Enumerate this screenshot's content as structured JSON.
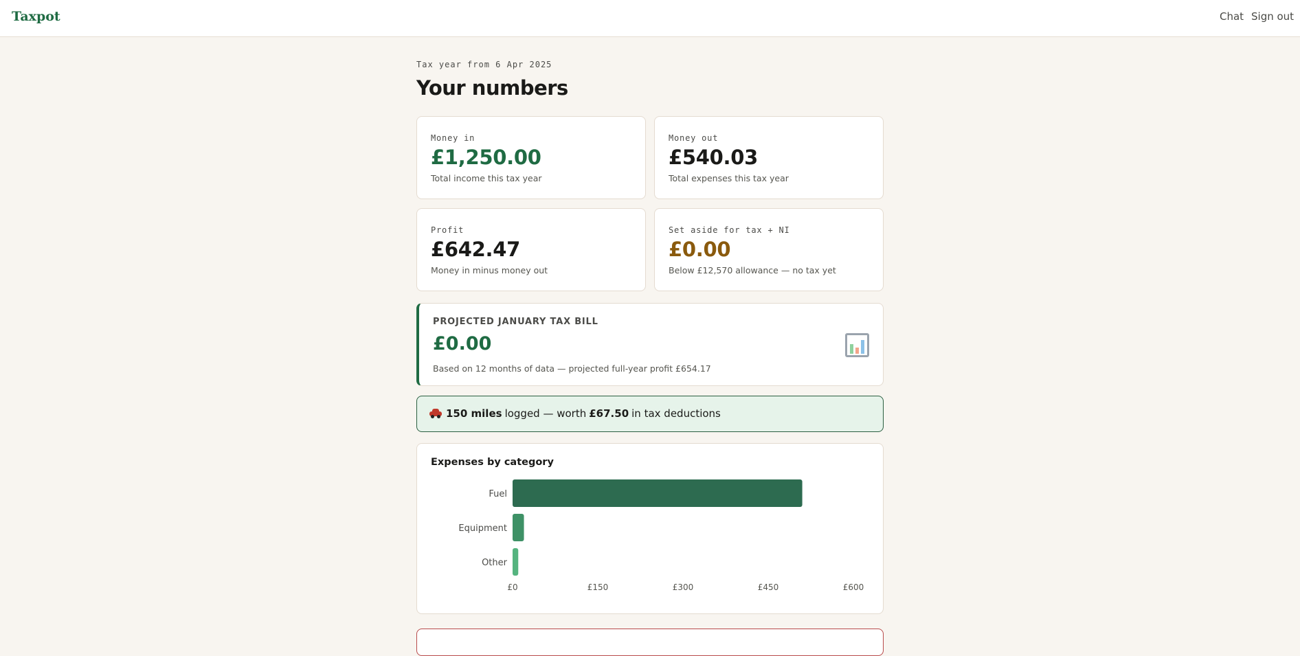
{
  "header": {
    "logo": "Taxpot",
    "nav": {
      "chat": "Chat",
      "sign_out": "Sign out"
    }
  },
  "main": {
    "eyebrow": "Tax year from 6 Apr 2025",
    "title": "Your numbers",
    "stats": {
      "money_in": {
        "label": "Money in",
        "value": "£1,250.00",
        "sub": "Total income this tax year"
      },
      "money_out": {
        "label": "Money out",
        "value": "£540.03",
        "sub": "Total expenses this tax year"
      },
      "profit": {
        "label": "Profit",
        "value": "£642.47",
        "sub": "Money in minus money out"
      },
      "set_aside": {
        "label": "Set aside for tax + NI",
        "value": "£0.00",
        "sub": "Below £12,570 allowance — no tax yet"
      }
    },
    "projected": {
      "label": "PROJECTED JANUARY TAX BILL",
      "value": "£0.00",
      "sub": "Based on 12 months of data — projected full-year profit £654.17",
      "icon": "bar-chart-icon"
    },
    "mileage": {
      "icon": "car-icon",
      "miles": "150 miles",
      "logged_text": "logged — worth",
      "worth": "£67.50",
      "tail_text": "in tax deductions"
    }
  },
  "colors": {
    "brand_green": "#1f6b43",
    "amber": "#8a5a0d",
    "bar_fuel": "#2d6b50",
    "bar_equipment": "#3e9166",
    "bar_other": "#55b47f"
  },
  "chart_data": {
    "type": "bar",
    "orientation": "horizontal",
    "title": "Expenses by category",
    "categories": [
      "Fuel",
      "Equipment",
      "Other"
    ],
    "values": [
      510,
      20,
      10
    ],
    "xlim": [
      0,
      600
    ],
    "xticks": [
      0,
      150,
      300,
      450,
      600
    ],
    "xtick_labels": [
      "£0",
      "£150",
      "£300",
      "£450",
      "£600"
    ],
    "grid": false,
    "legend": "none"
  }
}
